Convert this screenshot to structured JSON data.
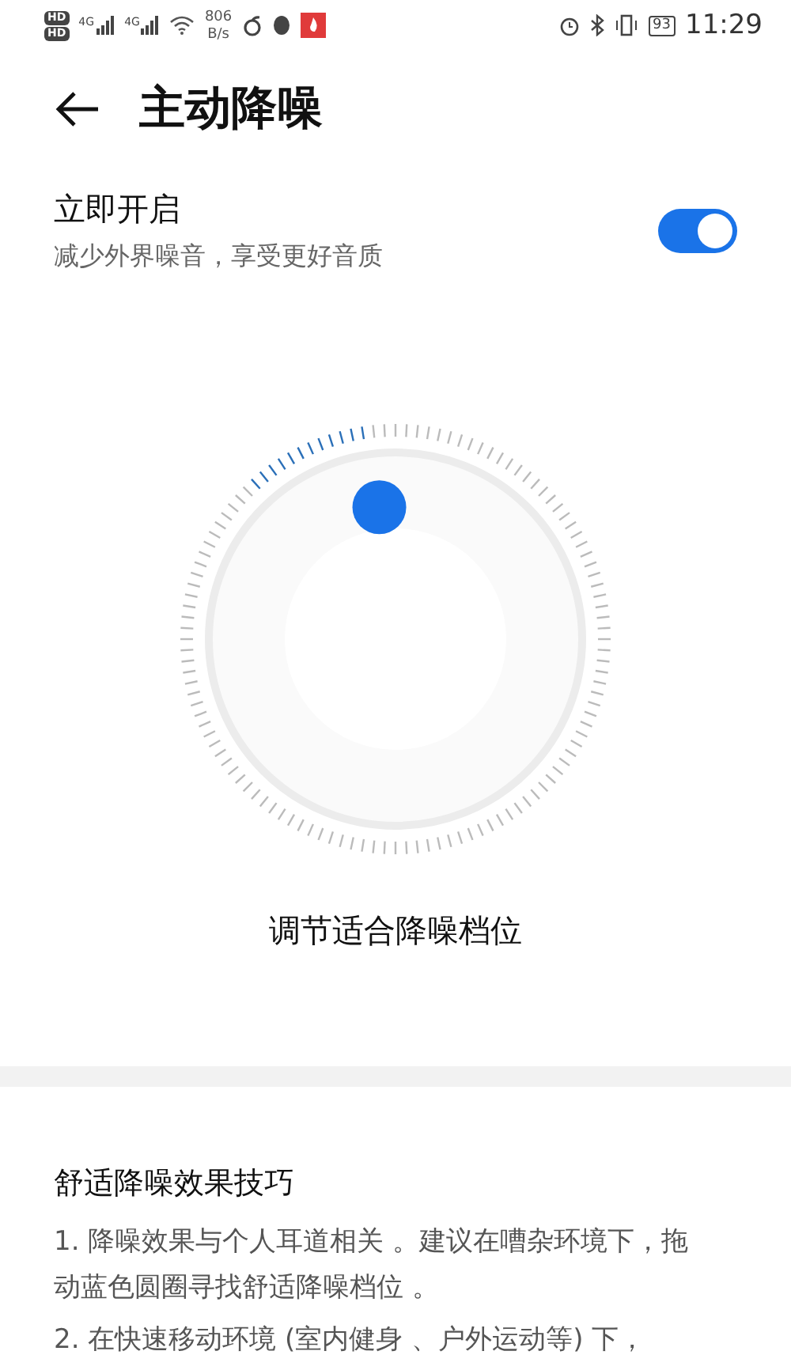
{
  "status_bar": {
    "left": [
      "HD",
      "HD",
      "4G",
      "4G"
    ],
    "speed": [
      "806",
      "B/s"
    ],
    "battery": "93",
    "time": "11:29"
  },
  "header": {
    "title": "主动降噪"
  },
  "setting": {
    "title": "立即开启",
    "subtitle": "减少外界噪音，享受更好音质",
    "on": true
  },
  "dial": {
    "caption": "调节适合降噪档位"
  },
  "tips": {
    "title": "舒适降噪效果技巧",
    "items": [
      "1. 降噪效果与个人耳道相关 。建议在嘈杂环境下，拖动蓝色圆圈寻找舒适降噪档位 。",
      "2. 在快速移动环境 (室内健身 、户外运动等) 下，"
    ]
  }
}
